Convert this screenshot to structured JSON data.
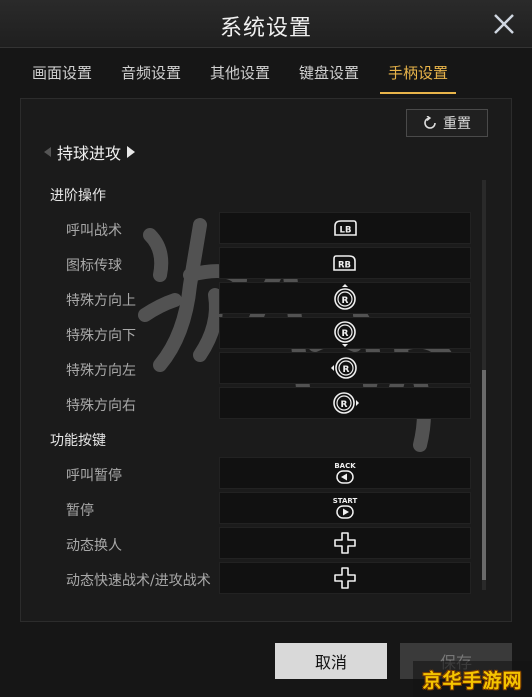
{
  "window": {
    "title": "系统设置"
  },
  "tabs": [
    {
      "label": "画面设置"
    },
    {
      "label": "音频设置"
    },
    {
      "label": "其他设置"
    },
    {
      "label": "键盘设置"
    },
    {
      "label": "手柄设置"
    }
  ],
  "active_tab_index": 4,
  "reset_label": "重置",
  "section": {
    "title": "持球进攻"
  },
  "groups": [
    {
      "title": "进阶操作",
      "rows": [
        {
          "label": "呼叫战术",
          "binding": "LB",
          "icon": "lb-button-icon"
        },
        {
          "label": "图标传球",
          "binding": "RB",
          "icon": "rb-button-icon"
        },
        {
          "label": "特殊方向上",
          "binding": "R",
          "icon": "right-stick-up-icon"
        },
        {
          "label": "特殊方向下",
          "binding": "R",
          "icon": "right-stick-down-icon"
        },
        {
          "label": "特殊方向左",
          "binding": "R",
          "icon": "right-stick-left-icon"
        },
        {
          "label": "特殊方向右",
          "binding": "R",
          "icon": "right-stick-right-icon"
        }
      ]
    },
    {
      "title": "功能按键",
      "rows": [
        {
          "label": "呼叫暂停",
          "binding": "BACK",
          "icon": "back-button-icon"
        },
        {
          "label": "暂停",
          "binding": "START",
          "icon": "start-button-icon"
        },
        {
          "label": "动态换人",
          "binding": "",
          "icon": "dpad-icon"
        },
        {
          "label": "动态快速战术/进攻战术",
          "binding": "",
          "icon": "dpad-icon"
        }
      ]
    }
  ],
  "footer": {
    "cancel_label": "取消",
    "save_label": "保存"
  },
  "brand_text": "京华手游网",
  "colors": {
    "accent": "#e8b44a",
    "background": "#161616",
    "panel": "#1b1b1b"
  }
}
